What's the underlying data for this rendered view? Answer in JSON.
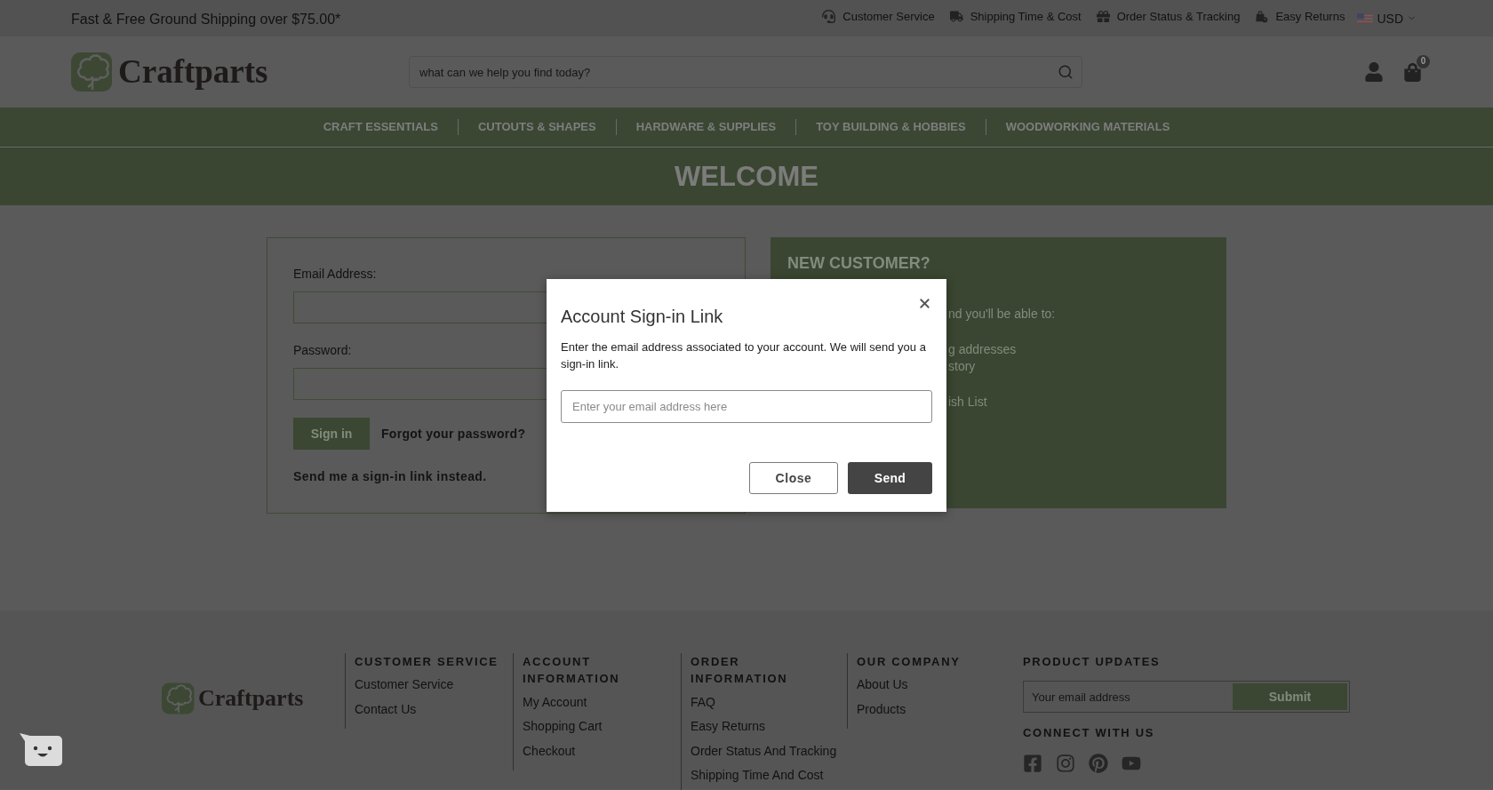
{
  "top_bar": {
    "promo": "Fast & Free Ground Shipping over $75.00*",
    "links": [
      {
        "kind": "headset",
        "label": "Customer Service"
      },
      {
        "kind": "truck",
        "label": "Shipping Time & Cost"
      },
      {
        "kind": "gift",
        "label": "Order Status & Tracking"
      },
      {
        "kind": "returns",
        "label": "Easy Returns"
      }
    ],
    "currency": "USD"
  },
  "header": {
    "logo": "Craftparts",
    "search": {
      "placeholder": "what can we help you find today?"
    },
    "cart_count": "0"
  },
  "nav": [
    "CRAFT ESSENTIALS",
    "CUTOUTS & SHAPES",
    "HARDWARE & SUPPLIES",
    "TOY BUILDING & HOBBIES",
    "WOODWORKING MATERIALS"
  ],
  "banner": {
    "title": "WELCOME"
  },
  "sign_in_form": {
    "fields": [
      {
        "label": "Email Address:"
      },
      {
        "label": "Password:"
      }
    ],
    "button": "Sign in",
    "forgot_link": "Forgot your password?",
    "sign_in_link": "Send me a sign-in link instead."
  },
  "new_customer": {
    "title": "NEW CUSTOMER?",
    "lines": [
      "nd you'll be able to:",
      "g addresses",
      "story",
      "ish List"
    ]
  },
  "modal": {
    "title": "Account Sign-in Link",
    "text": "Enter the email address associated to your account. We will send you a sign-in link.",
    "email": {
      "placeholder": "Enter your email address here"
    },
    "buttons": [
      {
        "kind": "secondary",
        "label": "Close"
      },
      {
        "kind": "primary",
        "label": "Send"
      }
    ]
  },
  "footer": {
    "logo": "Craftparts",
    "columns": [
      {
        "heading": "CUSTOMER SERVICE",
        "links": [
          "Customer Service",
          "Contact Us"
        ]
      },
      {
        "heading": "ACCOUNT INFORMATION",
        "links": [
          "My Account",
          "Shopping Cart",
          "Checkout"
        ]
      },
      {
        "heading": "ORDER INFORMATION",
        "links": [
          "FAQ",
          "Easy Returns",
          "Order Status And Tracking",
          "Shipping Time And Cost"
        ]
      },
      {
        "heading": "OUR COMPANY",
        "links": [
          "About Us",
          "Products"
        ]
      }
    ],
    "newsletter": {
      "heading": "PRODUCT UPDATES",
      "placeholder": "Your email address",
      "button": "Submit"
    },
    "social": {
      "heading": "CONNECT WITH US",
      "links": [
        {
          "kind": "facebook"
        },
        {
          "kind": "instagram"
        },
        {
          "kind": "pinterest"
        },
        {
          "kind": "youtube"
        }
      ]
    }
  }
}
